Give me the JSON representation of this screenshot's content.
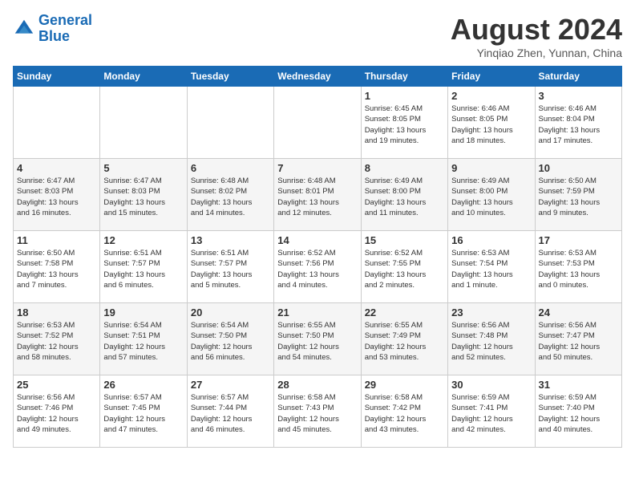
{
  "header": {
    "logo_line1": "General",
    "logo_line2": "Blue",
    "month": "August 2024",
    "location": "Yinqiao Zhen, Yunnan, China"
  },
  "weekdays": [
    "Sunday",
    "Monday",
    "Tuesday",
    "Wednesday",
    "Thursday",
    "Friday",
    "Saturday"
  ],
  "weeks": [
    [
      {
        "day": "",
        "info": ""
      },
      {
        "day": "",
        "info": ""
      },
      {
        "day": "",
        "info": ""
      },
      {
        "day": "",
        "info": ""
      },
      {
        "day": "1",
        "info": "Sunrise: 6:45 AM\nSunset: 8:05 PM\nDaylight: 13 hours\nand 19 minutes."
      },
      {
        "day": "2",
        "info": "Sunrise: 6:46 AM\nSunset: 8:05 PM\nDaylight: 13 hours\nand 18 minutes."
      },
      {
        "day": "3",
        "info": "Sunrise: 6:46 AM\nSunset: 8:04 PM\nDaylight: 13 hours\nand 17 minutes."
      }
    ],
    [
      {
        "day": "4",
        "info": "Sunrise: 6:47 AM\nSunset: 8:03 PM\nDaylight: 13 hours\nand 16 minutes."
      },
      {
        "day": "5",
        "info": "Sunrise: 6:47 AM\nSunset: 8:03 PM\nDaylight: 13 hours\nand 15 minutes."
      },
      {
        "day": "6",
        "info": "Sunrise: 6:48 AM\nSunset: 8:02 PM\nDaylight: 13 hours\nand 14 minutes."
      },
      {
        "day": "7",
        "info": "Sunrise: 6:48 AM\nSunset: 8:01 PM\nDaylight: 13 hours\nand 12 minutes."
      },
      {
        "day": "8",
        "info": "Sunrise: 6:49 AM\nSunset: 8:00 PM\nDaylight: 13 hours\nand 11 minutes."
      },
      {
        "day": "9",
        "info": "Sunrise: 6:49 AM\nSunset: 8:00 PM\nDaylight: 13 hours\nand 10 minutes."
      },
      {
        "day": "10",
        "info": "Sunrise: 6:50 AM\nSunset: 7:59 PM\nDaylight: 13 hours\nand 9 minutes."
      }
    ],
    [
      {
        "day": "11",
        "info": "Sunrise: 6:50 AM\nSunset: 7:58 PM\nDaylight: 13 hours\nand 7 minutes."
      },
      {
        "day": "12",
        "info": "Sunrise: 6:51 AM\nSunset: 7:57 PM\nDaylight: 13 hours\nand 6 minutes."
      },
      {
        "day": "13",
        "info": "Sunrise: 6:51 AM\nSunset: 7:57 PM\nDaylight: 13 hours\nand 5 minutes."
      },
      {
        "day": "14",
        "info": "Sunrise: 6:52 AM\nSunset: 7:56 PM\nDaylight: 13 hours\nand 4 minutes."
      },
      {
        "day": "15",
        "info": "Sunrise: 6:52 AM\nSunset: 7:55 PM\nDaylight: 13 hours\nand 2 minutes."
      },
      {
        "day": "16",
        "info": "Sunrise: 6:53 AM\nSunset: 7:54 PM\nDaylight: 13 hours\nand 1 minute."
      },
      {
        "day": "17",
        "info": "Sunrise: 6:53 AM\nSunset: 7:53 PM\nDaylight: 13 hours\nand 0 minutes."
      }
    ],
    [
      {
        "day": "18",
        "info": "Sunrise: 6:53 AM\nSunset: 7:52 PM\nDaylight: 12 hours\nand 58 minutes."
      },
      {
        "day": "19",
        "info": "Sunrise: 6:54 AM\nSunset: 7:51 PM\nDaylight: 12 hours\nand 57 minutes."
      },
      {
        "day": "20",
        "info": "Sunrise: 6:54 AM\nSunset: 7:50 PM\nDaylight: 12 hours\nand 56 minutes."
      },
      {
        "day": "21",
        "info": "Sunrise: 6:55 AM\nSunset: 7:50 PM\nDaylight: 12 hours\nand 54 minutes."
      },
      {
        "day": "22",
        "info": "Sunrise: 6:55 AM\nSunset: 7:49 PM\nDaylight: 12 hours\nand 53 minutes."
      },
      {
        "day": "23",
        "info": "Sunrise: 6:56 AM\nSunset: 7:48 PM\nDaylight: 12 hours\nand 52 minutes."
      },
      {
        "day": "24",
        "info": "Sunrise: 6:56 AM\nSunset: 7:47 PM\nDaylight: 12 hours\nand 50 minutes."
      }
    ],
    [
      {
        "day": "25",
        "info": "Sunrise: 6:56 AM\nSunset: 7:46 PM\nDaylight: 12 hours\nand 49 minutes."
      },
      {
        "day": "26",
        "info": "Sunrise: 6:57 AM\nSunset: 7:45 PM\nDaylight: 12 hours\nand 47 minutes."
      },
      {
        "day": "27",
        "info": "Sunrise: 6:57 AM\nSunset: 7:44 PM\nDaylight: 12 hours\nand 46 minutes."
      },
      {
        "day": "28",
        "info": "Sunrise: 6:58 AM\nSunset: 7:43 PM\nDaylight: 12 hours\nand 45 minutes."
      },
      {
        "day": "29",
        "info": "Sunrise: 6:58 AM\nSunset: 7:42 PM\nDaylight: 12 hours\nand 43 minutes."
      },
      {
        "day": "30",
        "info": "Sunrise: 6:59 AM\nSunset: 7:41 PM\nDaylight: 12 hours\nand 42 minutes."
      },
      {
        "day": "31",
        "info": "Sunrise: 6:59 AM\nSunset: 7:40 PM\nDaylight: 12 hours\nand 40 minutes."
      }
    ]
  ]
}
